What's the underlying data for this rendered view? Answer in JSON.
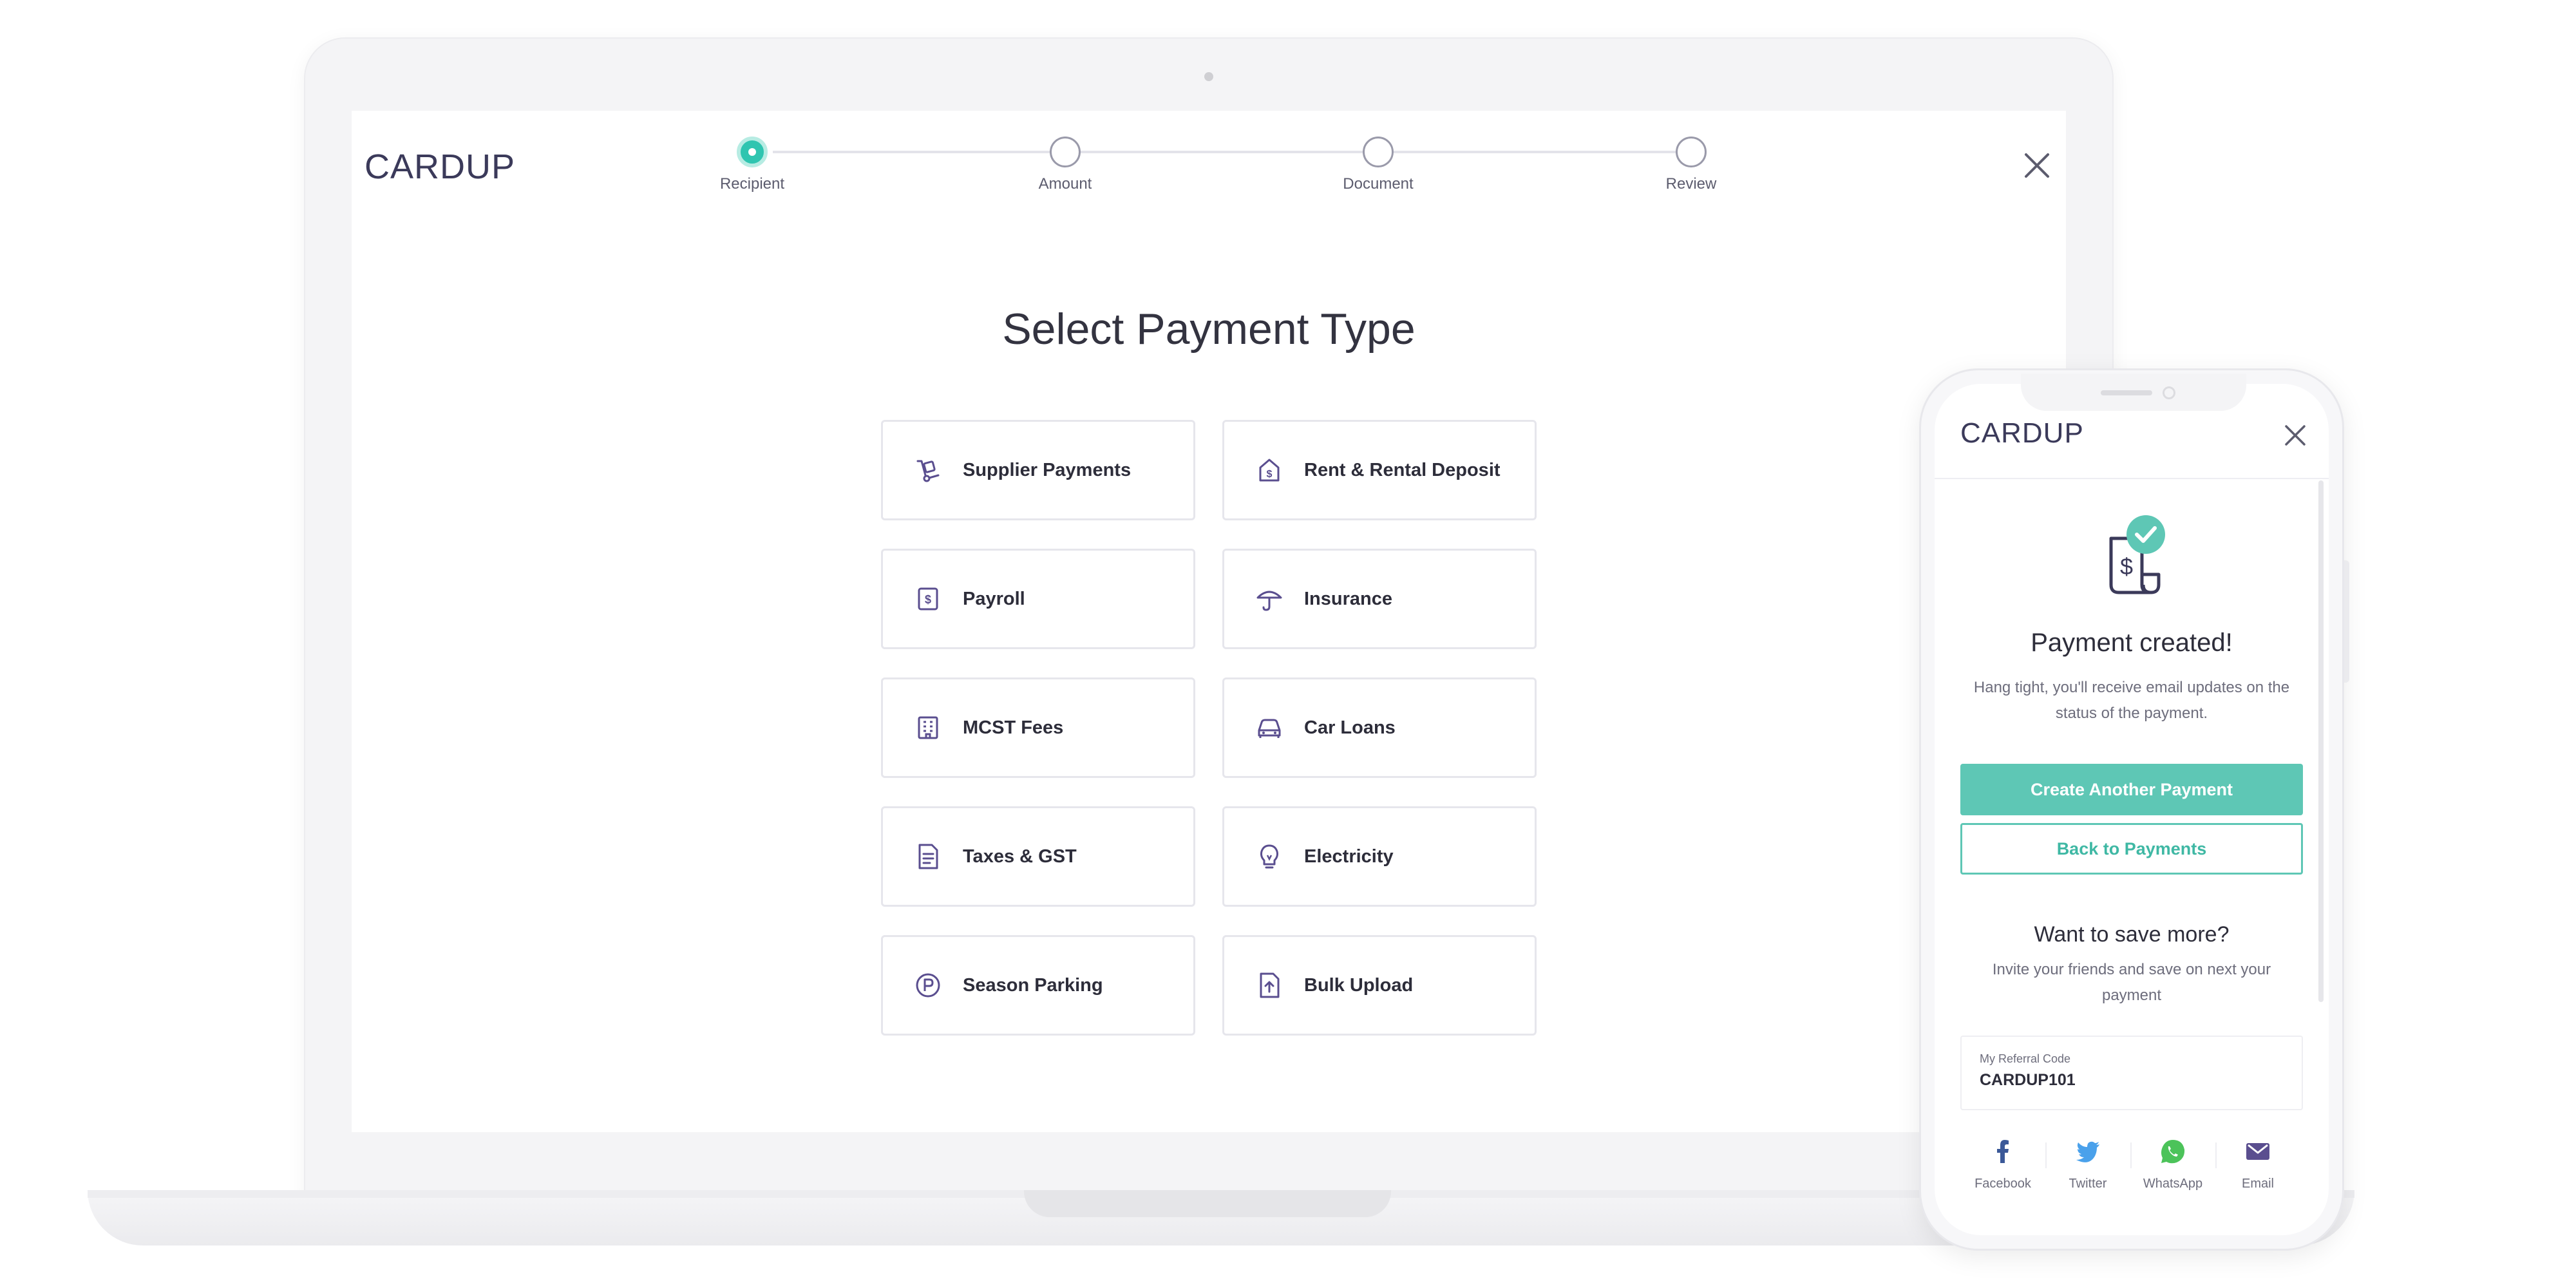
{
  "desktop": {
    "brand": "CARDUP",
    "stepper": {
      "steps": [
        {
          "label": "Recipient",
          "state": "active"
        },
        {
          "label": "Amount",
          "state": "pending"
        },
        {
          "label": "Document",
          "state": "pending"
        },
        {
          "label": "Review",
          "state": "pending"
        }
      ]
    },
    "title": "Select Payment Type",
    "payment_types": [
      {
        "label": "Supplier Payments",
        "icon": "hand-truck-icon"
      },
      {
        "label": "Rent & Rental Deposit",
        "icon": "house-dollar-icon"
      },
      {
        "label": "Payroll",
        "icon": "receipt-dollar-icon"
      },
      {
        "label": "Insurance",
        "icon": "umbrella-icon"
      },
      {
        "label": "MCST Fees",
        "icon": "building-icon"
      },
      {
        "label": "Car Loans",
        "icon": "car-icon"
      },
      {
        "label": "Taxes & GST",
        "icon": "document-icon"
      },
      {
        "label": "Electricity",
        "icon": "lightbulb-icon"
      },
      {
        "label": "Season Parking",
        "icon": "parking-icon"
      },
      {
        "label": "Bulk Upload",
        "icon": "upload-file-icon"
      }
    ]
  },
  "mobile": {
    "brand": "CARDUP",
    "success_title": "Payment created!",
    "success_desc": "Hang tight, you'll receive email updates on the status of the payment.",
    "primary_button": "Create Another Payment",
    "secondary_button": "Back to Payments",
    "save_title": "Want to save more?",
    "save_desc": "Invite your friends and save on next your payment",
    "referral": {
      "label": "My Referral Code",
      "code": "CARDUP101"
    },
    "share": [
      {
        "label": "Facebook",
        "icon": "facebook-icon",
        "color": "#3b5998"
      },
      {
        "label": "Twitter",
        "icon": "twitter-icon",
        "color": "#4aa1eb"
      },
      {
        "label": "WhatsApp",
        "icon": "whatsapp-icon",
        "color": "#4cc35a"
      },
      {
        "label": "Email",
        "icon": "email-icon",
        "color": "#5a4e8f"
      }
    ]
  },
  "colors": {
    "accent": "#2fc5b0",
    "button": "#5ec7b5",
    "icon": "#5a4e8f",
    "text": "#2d2d3a"
  }
}
